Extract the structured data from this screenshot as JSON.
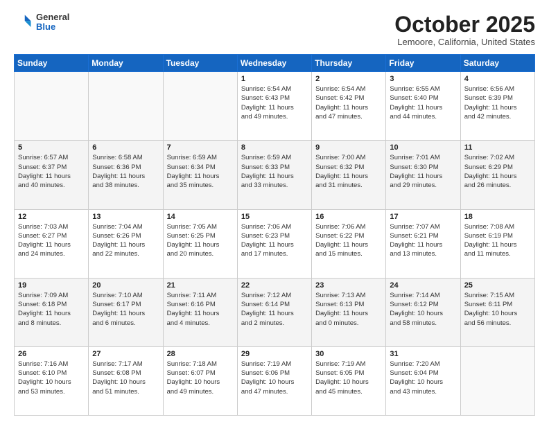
{
  "header": {
    "logo_general": "General",
    "logo_blue": "Blue",
    "month_title": "October 2025",
    "location": "Lemoore, California, United States"
  },
  "weekdays": [
    "Sunday",
    "Monday",
    "Tuesday",
    "Wednesday",
    "Thursday",
    "Friday",
    "Saturday"
  ],
  "weeks": [
    [
      {
        "day": "",
        "info": ""
      },
      {
        "day": "",
        "info": ""
      },
      {
        "day": "",
        "info": ""
      },
      {
        "day": "1",
        "info": "Sunrise: 6:54 AM\nSunset: 6:43 PM\nDaylight: 11 hours\nand 49 minutes."
      },
      {
        "day": "2",
        "info": "Sunrise: 6:54 AM\nSunset: 6:42 PM\nDaylight: 11 hours\nand 47 minutes."
      },
      {
        "day": "3",
        "info": "Sunrise: 6:55 AM\nSunset: 6:40 PM\nDaylight: 11 hours\nand 44 minutes."
      },
      {
        "day": "4",
        "info": "Sunrise: 6:56 AM\nSunset: 6:39 PM\nDaylight: 11 hours\nand 42 minutes."
      }
    ],
    [
      {
        "day": "5",
        "info": "Sunrise: 6:57 AM\nSunset: 6:37 PM\nDaylight: 11 hours\nand 40 minutes."
      },
      {
        "day": "6",
        "info": "Sunrise: 6:58 AM\nSunset: 6:36 PM\nDaylight: 11 hours\nand 38 minutes."
      },
      {
        "day": "7",
        "info": "Sunrise: 6:59 AM\nSunset: 6:34 PM\nDaylight: 11 hours\nand 35 minutes."
      },
      {
        "day": "8",
        "info": "Sunrise: 6:59 AM\nSunset: 6:33 PM\nDaylight: 11 hours\nand 33 minutes."
      },
      {
        "day": "9",
        "info": "Sunrise: 7:00 AM\nSunset: 6:32 PM\nDaylight: 11 hours\nand 31 minutes."
      },
      {
        "day": "10",
        "info": "Sunrise: 7:01 AM\nSunset: 6:30 PM\nDaylight: 11 hours\nand 29 minutes."
      },
      {
        "day": "11",
        "info": "Sunrise: 7:02 AM\nSunset: 6:29 PM\nDaylight: 11 hours\nand 26 minutes."
      }
    ],
    [
      {
        "day": "12",
        "info": "Sunrise: 7:03 AM\nSunset: 6:27 PM\nDaylight: 11 hours\nand 24 minutes."
      },
      {
        "day": "13",
        "info": "Sunrise: 7:04 AM\nSunset: 6:26 PM\nDaylight: 11 hours\nand 22 minutes."
      },
      {
        "day": "14",
        "info": "Sunrise: 7:05 AM\nSunset: 6:25 PM\nDaylight: 11 hours\nand 20 minutes."
      },
      {
        "day": "15",
        "info": "Sunrise: 7:06 AM\nSunset: 6:23 PM\nDaylight: 11 hours\nand 17 minutes."
      },
      {
        "day": "16",
        "info": "Sunrise: 7:06 AM\nSunset: 6:22 PM\nDaylight: 11 hours\nand 15 minutes."
      },
      {
        "day": "17",
        "info": "Sunrise: 7:07 AM\nSunset: 6:21 PM\nDaylight: 11 hours\nand 13 minutes."
      },
      {
        "day": "18",
        "info": "Sunrise: 7:08 AM\nSunset: 6:19 PM\nDaylight: 11 hours\nand 11 minutes."
      }
    ],
    [
      {
        "day": "19",
        "info": "Sunrise: 7:09 AM\nSunset: 6:18 PM\nDaylight: 11 hours\nand 8 minutes."
      },
      {
        "day": "20",
        "info": "Sunrise: 7:10 AM\nSunset: 6:17 PM\nDaylight: 11 hours\nand 6 minutes."
      },
      {
        "day": "21",
        "info": "Sunrise: 7:11 AM\nSunset: 6:16 PM\nDaylight: 11 hours\nand 4 minutes."
      },
      {
        "day": "22",
        "info": "Sunrise: 7:12 AM\nSunset: 6:14 PM\nDaylight: 11 hours\nand 2 minutes."
      },
      {
        "day": "23",
        "info": "Sunrise: 7:13 AM\nSunset: 6:13 PM\nDaylight: 11 hours\nand 0 minutes."
      },
      {
        "day": "24",
        "info": "Sunrise: 7:14 AM\nSunset: 6:12 PM\nDaylight: 10 hours\nand 58 minutes."
      },
      {
        "day": "25",
        "info": "Sunrise: 7:15 AM\nSunset: 6:11 PM\nDaylight: 10 hours\nand 56 minutes."
      }
    ],
    [
      {
        "day": "26",
        "info": "Sunrise: 7:16 AM\nSunset: 6:10 PM\nDaylight: 10 hours\nand 53 minutes."
      },
      {
        "day": "27",
        "info": "Sunrise: 7:17 AM\nSunset: 6:08 PM\nDaylight: 10 hours\nand 51 minutes."
      },
      {
        "day": "28",
        "info": "Sunrise: 7:18 AM\nSunset: 6:07 PM\nDaylight: 10 hours\nand 49 minutes."
      },
      {
        "day": "29",
        "info": "Sunrise: 7:19 AM\nSunset: 6:06 PM\nDaylight: 10 hours\nand 47 minutes."
      },
      {
        "day": "30",
        "info": "Sunrise: 7:19 AM\nSunset: 6:05 PM\nDaylight: 10 hours\nand 45 minutes."
      },
      {
        "day": "31",
        "info": "Sunrise: 7:20 AM\nSunset: 6:04 PM\nDaylight: 10 hours\nand 43 minutes."
      },
      {
        "day": "",
        "info": ""
      }
    ]
  ]
}
